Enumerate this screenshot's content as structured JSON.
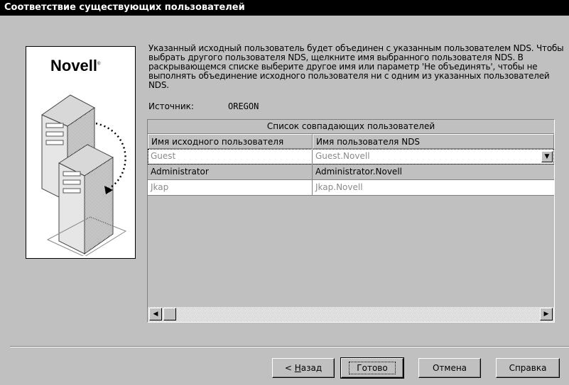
{
  "window": {
    "title": "Соответствие существующих пользователей"
  },
  "brand": {
    "logo_text": "Novell",
    "trademark": "®"
  },
  "description": "Указанный исходный пользователь будет объединен с указанным пользователем NDS. Чтобы выбрать другого пользователя NDS, щелкните имя выбранного пользователя NDS. В раскрывающемся списке выберите другое имя или параметр 'Не объединять', чтобы не выполнять объединение исходного пользователя ни с одним из указанных пользователей NDS.",
  "source": {
    "label": "Источник:",
    "value": "OREGON"
  },
  "match_list": {
    "caption": "Список совпадающих пользователей",
    "columns": [
      "Имя исходного пользователя",
      "Имя пользователя NDS"
    ],
    "rows": [
      {
        "source": "Guest",
        "nds": "Guest.Novell"
      },
      {
        "source": "Administrator",
        "nds": "Administrator.Novell"
      },
      {
        "source": "Jkap",
        "nds": "Jkap.Novell"
      }
    ],
    "dropdown_icon": "triangle-down-icon",
    "scroll_left_icon": "triangle-left-icon",
    "scroll_right_icon": "triangle-right-icon"
  },
  "buttons": {
    "back_prefix": "< ",
    "back_accel": "Н",
    "back_rest": "азад",
    "finish": "Готово",
    "cancel": "Отмена",
    "help": "Справка"
  },
  "colors": {
    "titlebar": "#000000",
    "dialog": "#c0c0c0",
    "dim_text": "#8a8a8a"
  }
}
